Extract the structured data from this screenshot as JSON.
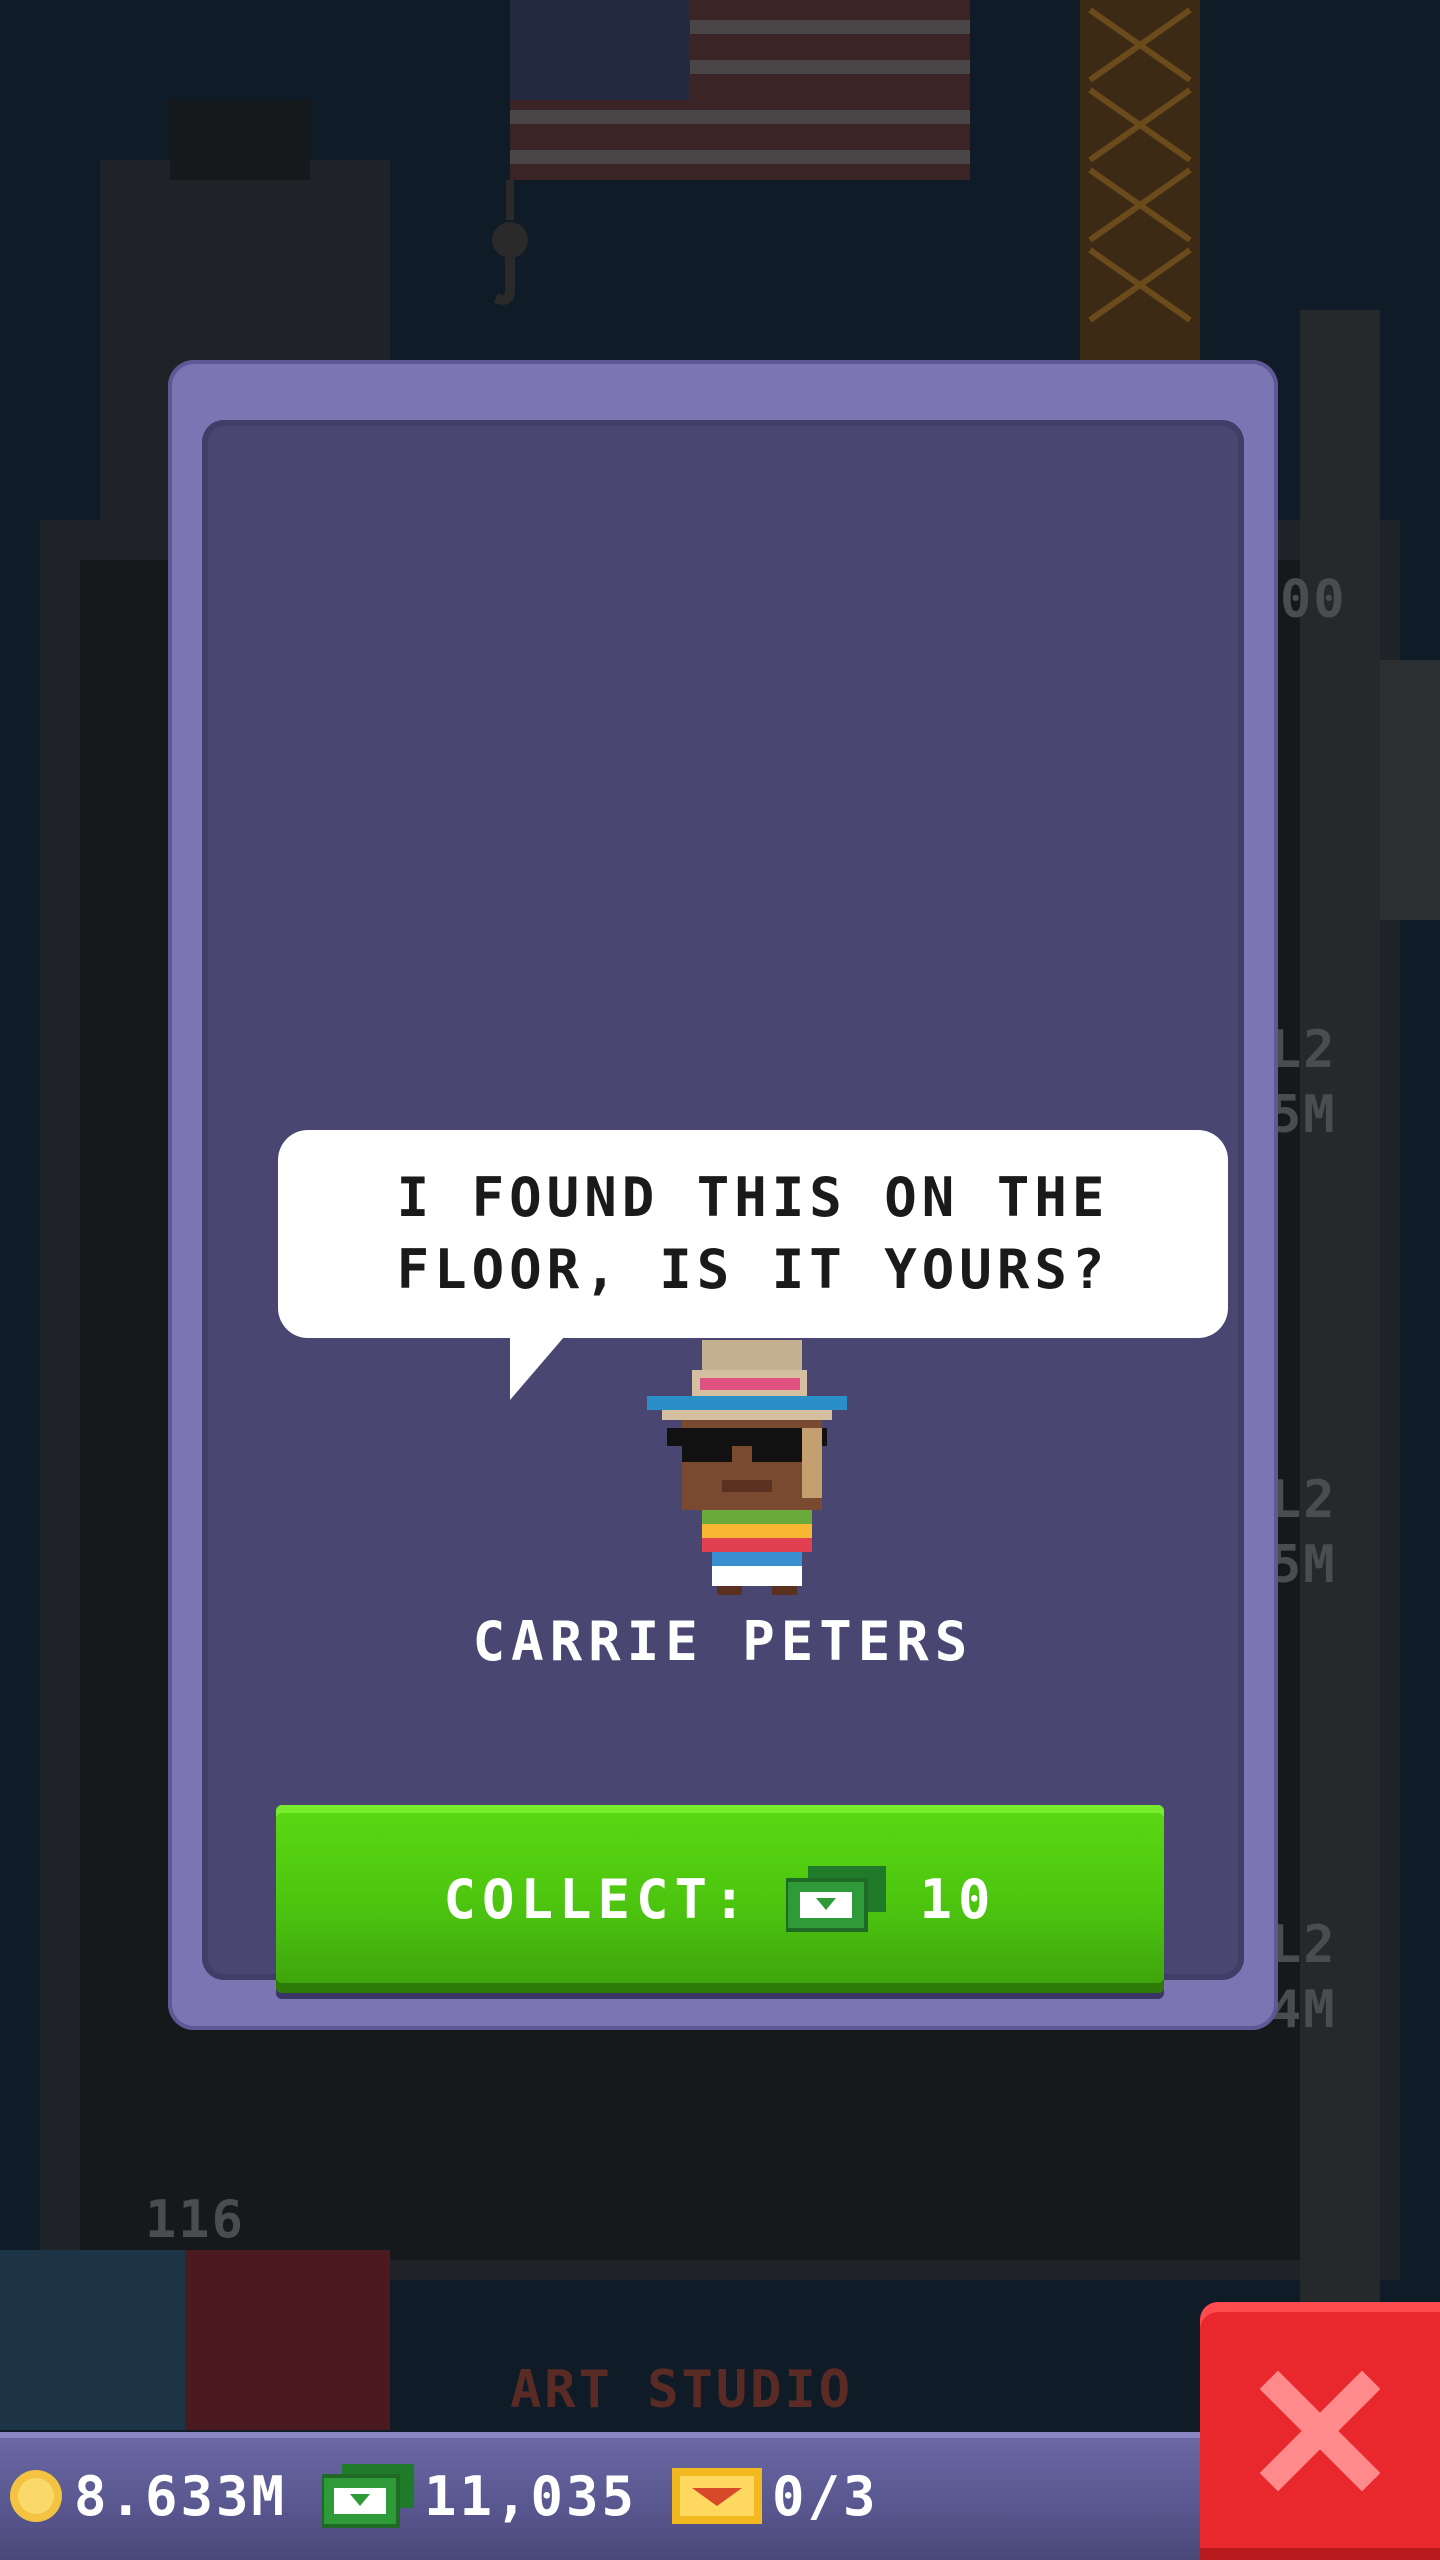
{
  "dialog": {
    "speech_line1": "I FOUND THIS ON THE",
    "speech_line2": "FLOOR, IS IT YOURS?",
    "character_name": "CARRIE PETERS",
    "collect_label": "COLLECT:",
    "collect_amount": "10"
  },
  "status_bar": {
    "coins": "8.633M",
    "bux": "11,035",
    "tickets": "0/3"
  },
  "background": {
    "floor_labels": [
      "L2",
      "5M",
      "L2",
      "5M",
      "L2",
      "4M",
      "116",
      "00"
    ],
    "floor_name": "ART STUDIO"
  },
  "colors": {
    "dialog_frame": "#7b75b3",
    "dialog_panel": "#4a4672",
    "collect_green": "#4cc40f",
    "close_red": "#e8282c"
  },
  "icons": [
    "coin-icon",
    "bux-icon",
    "ticket-icon",
    "close-icon",
    "cash-icon"
  ]
}
